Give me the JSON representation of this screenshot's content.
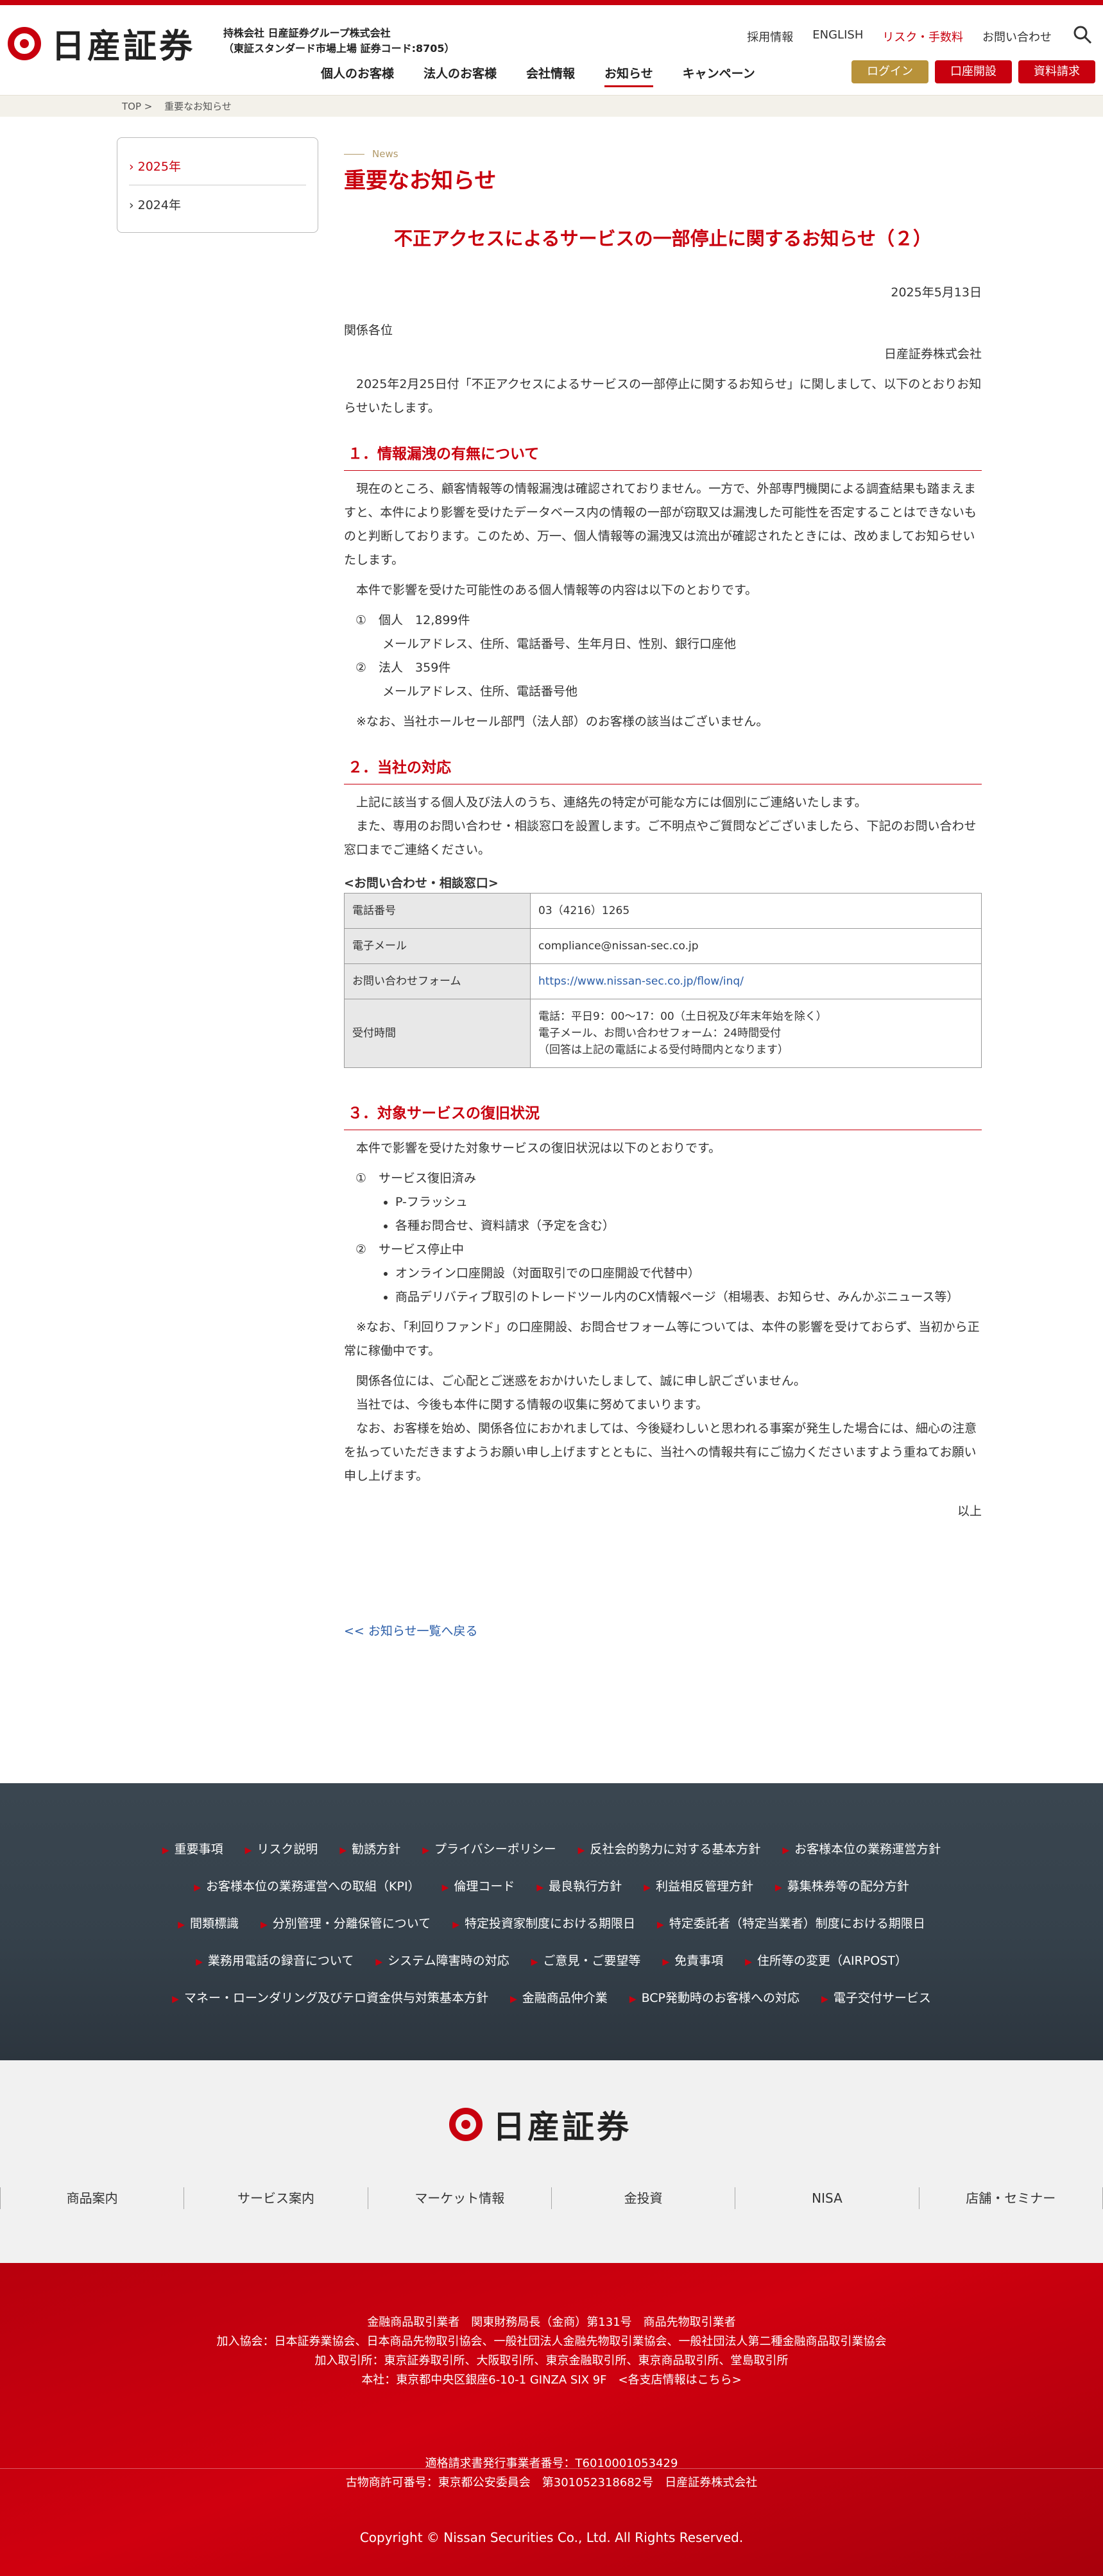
{
  "brand": {
    "logo_text": "日産証券",
    "holding_line1": "持株会社 日産証券グループ株式会社",
    "holding_line2": "（東証スタンダード市場上場 証券コード:8705）"
  },
  "util_nav": [
    "採用情報",
    "ENGLISH",
    "リスク・手数料",
    "お問い合わせ"
  ],
  "main_nav": [
    "個人のお客様",
    "法人のお客様",
    "会社情報",
    "お知らせ",
    "キャンペーン"
  ],
  "header_buttons": {
    "login": "ログイン",
    "open": "口座開設",
    "docs": "資料請求"
  },
  "breadcrumb": [
    "TOP",
    ">",
    "重要なお知らせ"
  ],
  "sidebar": [
    "2025年",
    "2024年"
  ],
  "content": {
    "section_label": "News",
    "page_title": "重要なお知らせ",
    "article_title": "不正アクセスによるサービスの一部停止に関するお知らせ（２）",
    "date": "2025年5月13日",
    "to": "関係各位",
    "from": "日産証券株式会社",
    "intro": "2025年2月25日付「不正アクセスによるサービスの一部停止に関するお知らせ」に関しまして、以下のとおりお知らせいたします。",
    "h1": "１．情報漏洩の有無について",
    "p1": "現在のところ、顧客情報等の情報漏洩は確認されておりません。一方で、外部専門機関による調査結果も踏まえますと、本件により影響を受けたデータベース内の情報の一部が窃取又は漏洩した可能性を否定することはできないものと判断しております。このため、万一、個人情報等の漏洩又は流出が確認されたときには、改めましてお知らせいたします。",
    "p2": "本件で影響を受けた可能性のある個人情報等の内容は以下のとおりです。",
    "item1": "①　個人　12,899件",
    "item1_sub": "メールアドレス、住所、電話番号、生年月日、性別、銀行口座他",
    "item2": "②　法人　359件",
    "item2_sub": "メールアドレス、住所、電話番号他",
    "note1": "※なお、当社ホールセール部門（法人部）のお客様の該当はございません。",
    "h2": "２．当社の対応",
    "p3": "上記に該当する個人及び法人のうち、連絡先の特定が可能な方には個別にご連絡いたします。",
    "p4": "また、専用のお問い合わせ・相談窓口を設置します。ご不明点やご質問などございましたら、下記のお問い合わせ窓口までご連絡ください。",
    "contact_heading": "<お問い合わせ・相談窓口>",
    "contact": {
      "phone_label": "電話番号",
      "phone": "03（4216）1265",
      "mail_label": "電子メール",
      "mail": "compliance@nissan-sec.co.jp",
      "form_label": "お問い合わせフォーム",
      "form": "https://www.nissan-sec.co.jp/flow/inq/",
      "hours_label": "受付時間",
      "hours1": "電話：平日9：00～17：00（土日祝及び年末年始を除く）",
      "hours2": "電子メール、お問い合わせフォーム：24時間受付",
      "hours3": "（回答は上記の電話による受付時間内となります）"
    },
    "h3": "３．対象サービスの復旧状況",
    "p5": "本件で影響を受けた対象サービスの復旧状況は以下のとおりです。",
    "restored_title": "①　サービス復旧済み",
    "restored": [
      "P-フラッシュ",
      "各種お問合せ、資料請求（予定を含む）"
    ],
    "stopped_title": "②　サービス停止中",
    "stopped": [
      "オンライン口座開設（対面取引での口座開設で代替中）",
      "商品デリバティブ取引のトレードツール内のCX情報ページ（相場表、お知らせ、みんかぶニュース等）"
    ],
    "note2": "※なお、「利回りファンド」の口座開設、お問合せフォーム等については、本件の影響を受けておらず、当初から正常に稼働中です。",
    "p6": "関係各位には、ご心配とご迷惑をおかけいたしまして、誠に申し訳ございません。",
    "p7": "当社では、今後も本件に関する情報の収集に努めてまいります。",
    "p8": "なお、お客様を始め、関係各位におかれましては、今後疑わしいと思われる事案が発生した場合には、細心の注意を払っていただきますようお願い申し上げますとともに、当社への情報共有にご協力くださいますよう重ねてお願い申し上げます。",
    "end": "以上",
    "back": "<< お知らせ一覧へ戻る"
  },
  "footer_links": [
    [
      "重要事項",
      "リスク説明",
      "勧誘方針",
      "プライバシーポリシー",
      "反社会的勢力に対する基本方針",
      "お客様本位の業務運営方針"
    ],
    [
      "お客様本位の業務運営への取組（KPI）",
      "倫理コード",
      "最良執行方針",
      "利益相反管理方針",
      "募集株券等の配分方針"
    ],
    [
      "間類標識",
      "分別管理・分離保管について",
      "特定投資家制度における期限日",
      "特定委託者（特定当業者）制度における期限日"
    ],
    [
      "業務用電話の録音について",
      "システム障害時の対応",
      "ご意見・ご要望等",
      "免責事項",
      "住所等の変更（AIRPOST）"
    ],
    [
      "マネー・ローンダリング及びテロ資金供与対策基本方針",
      "金融商品仲介業",
      "BCP発動時のお客様への対応",
      "電子交付サービス"
    ]
  ],
  "footer_cats": [
    "商品案内",
    "サービス案内",
    "マーケット情報",
    "金投資",
    "NISA",
    "店舗・セミナー"
  ],
  "footer_info": {
    "l1": "金融商品取引業者　関東財務局長（金商）第131号　商品先物取引業者",
    "l2": "加入協会：日本証券業協会、日本商品先物取引協会、一般社団法人金融先物取引業協会、一般社団法人第二種金融商品取引業協会",
    "l3": "加入取引所：東京証券取引所、大阪取引所、東京金融取引所、東京商品取引所、堂島取引所",
    "l4": "本社：東京都中央区銀座6-10-1 GINZA SIX 9F　<各支店情報はこちら>",
    "l5": "適格請求書発行事業者番号：T6010001053429",
    "l6": "古物商許可番号：東京都公安委員会　第301052318682号　日産証券株式会社",
    "copyright": "Copyright © Nissan Securities Co., Ltd. All Rights Reserved."
  },
  "colors": {
    "brand_red": "#c8000e",
    "gold": "#b8923a",
    "link_blue": "#2a5da8",
    "footer_dark": "#36424c"
  }
}
